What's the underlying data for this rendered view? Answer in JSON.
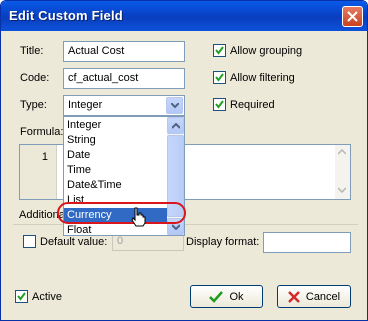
{
  "window": {
    "title": "Edit Custom Field"
  },
  "fields": {
    "title_label": "Title:",
    "title_value": "Actual Cost",
    "code_label": "Code:",
    "code_value": "cf_actual_cost",
    "type_label": "Type:",
    "type_value": "Integer",
    "formula_label": "Formula:"
  },
  "checkboxes": {
    "allow_grouping": "Allow grouping",
    "allow_filtering": "Allow filtering",
    "required": "Required",
    "active": "Active"
  },
  "editor": {
    "line_number": "1"
  },
  "additional": {
    "group_label": "Additional",
    "default_value_label": "Default value:",
    "default_value": "0",
    "display_format_label": "Display format:"
  },
  "type_dropdown": {
    "options": [
      "Integer",
      "String",
      "Date",
      "Time",
      "Date&Time",
      "List",
      "Currency",
      "Float"
    ],
    "highlighted_option": "Currency"
  },
  "buttons": {
    "ok": "Ok",
    "cancel": "Cancel"
  },
  "colors": {
    "titlebar": "#0a50d8",
    "selection": "#316ac5",
    "annotation": "#d8161b"
  }
}
